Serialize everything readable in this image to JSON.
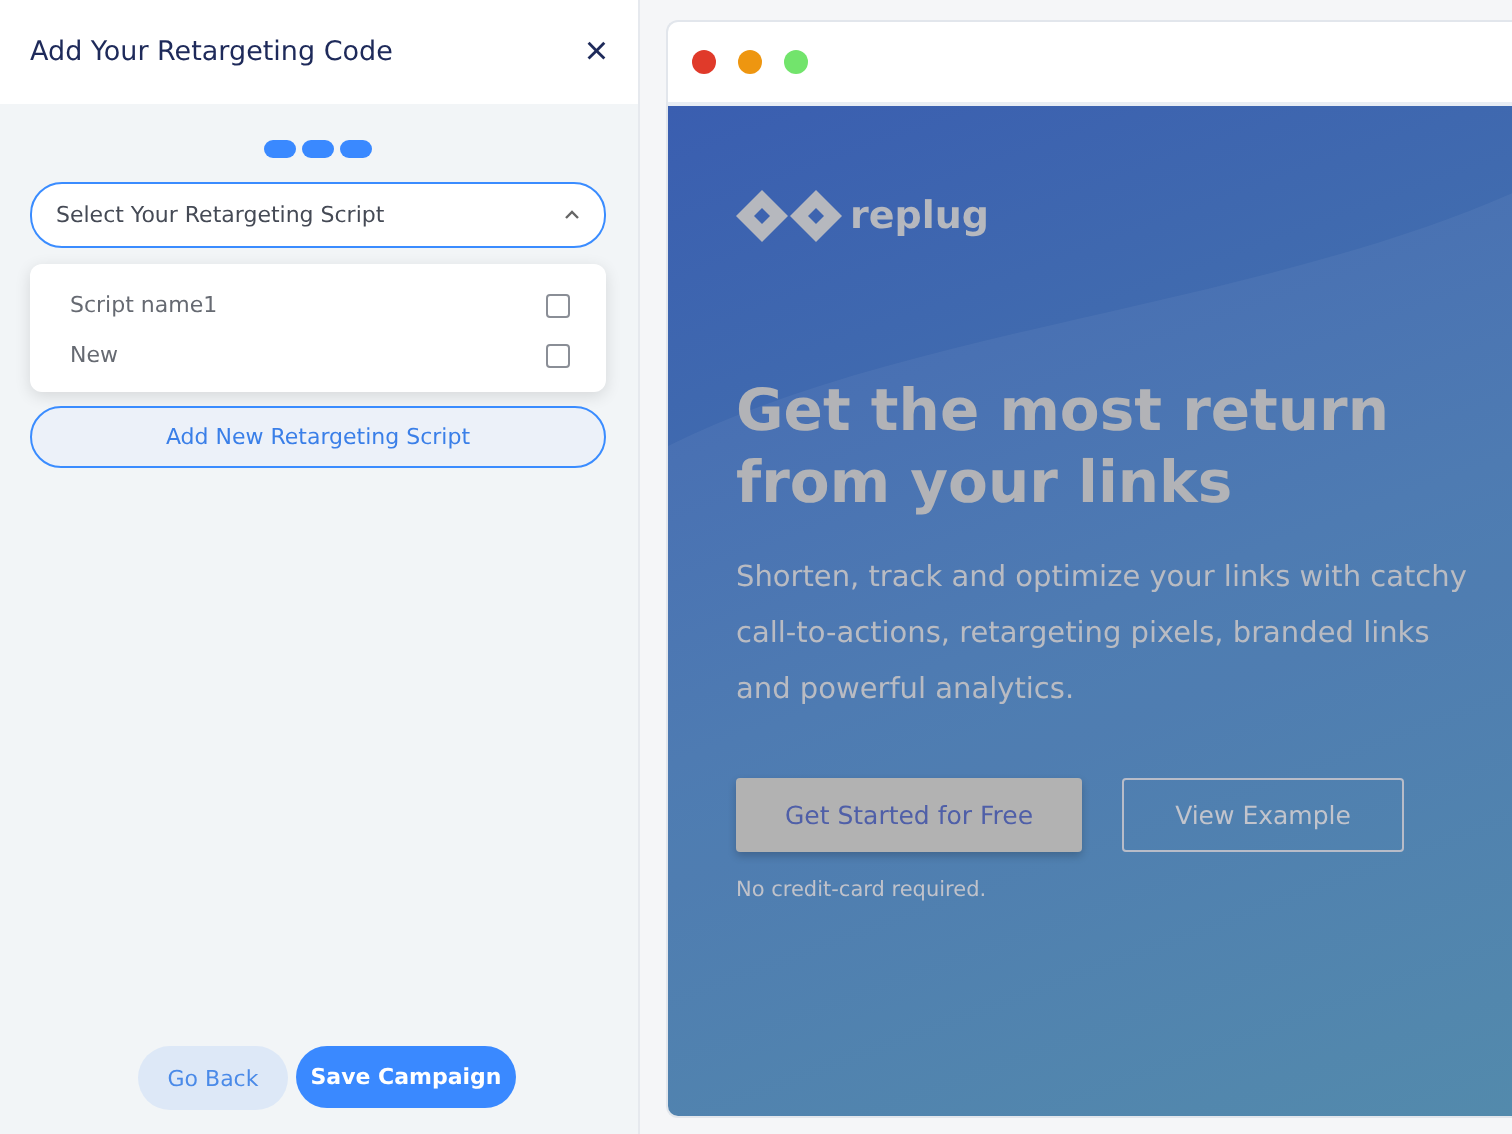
{
  "panel": {
    "title": "Add Your Retargeting Code",
    "close": "×"
  },
  "dropdown": {
    "placeholder": "Select Your Retargeting Script",
    "expanded": true,
    "options": [
      {
        "label": "Script name1",
        "checked": false
      },
      {
        "label": "New",
        "checked": false
      }
    ]
  },
  "add_button": "Add New Retargeting Script",
  "footer": {
    "back": "Go Back",
    "save": "Save Campaign"
  },
  "preview": {
    "brand": "replug",
    "headline": "Get the most return from your links",
    "text": "Shorten, track and optimize your links with catchy call-to-actions, retargeting pixels, branded links and powerful analytics.",
    "primary": "Get Started for Free",
    "secondary": "View Example",
    "note": "No credit-card required."
  }
}
